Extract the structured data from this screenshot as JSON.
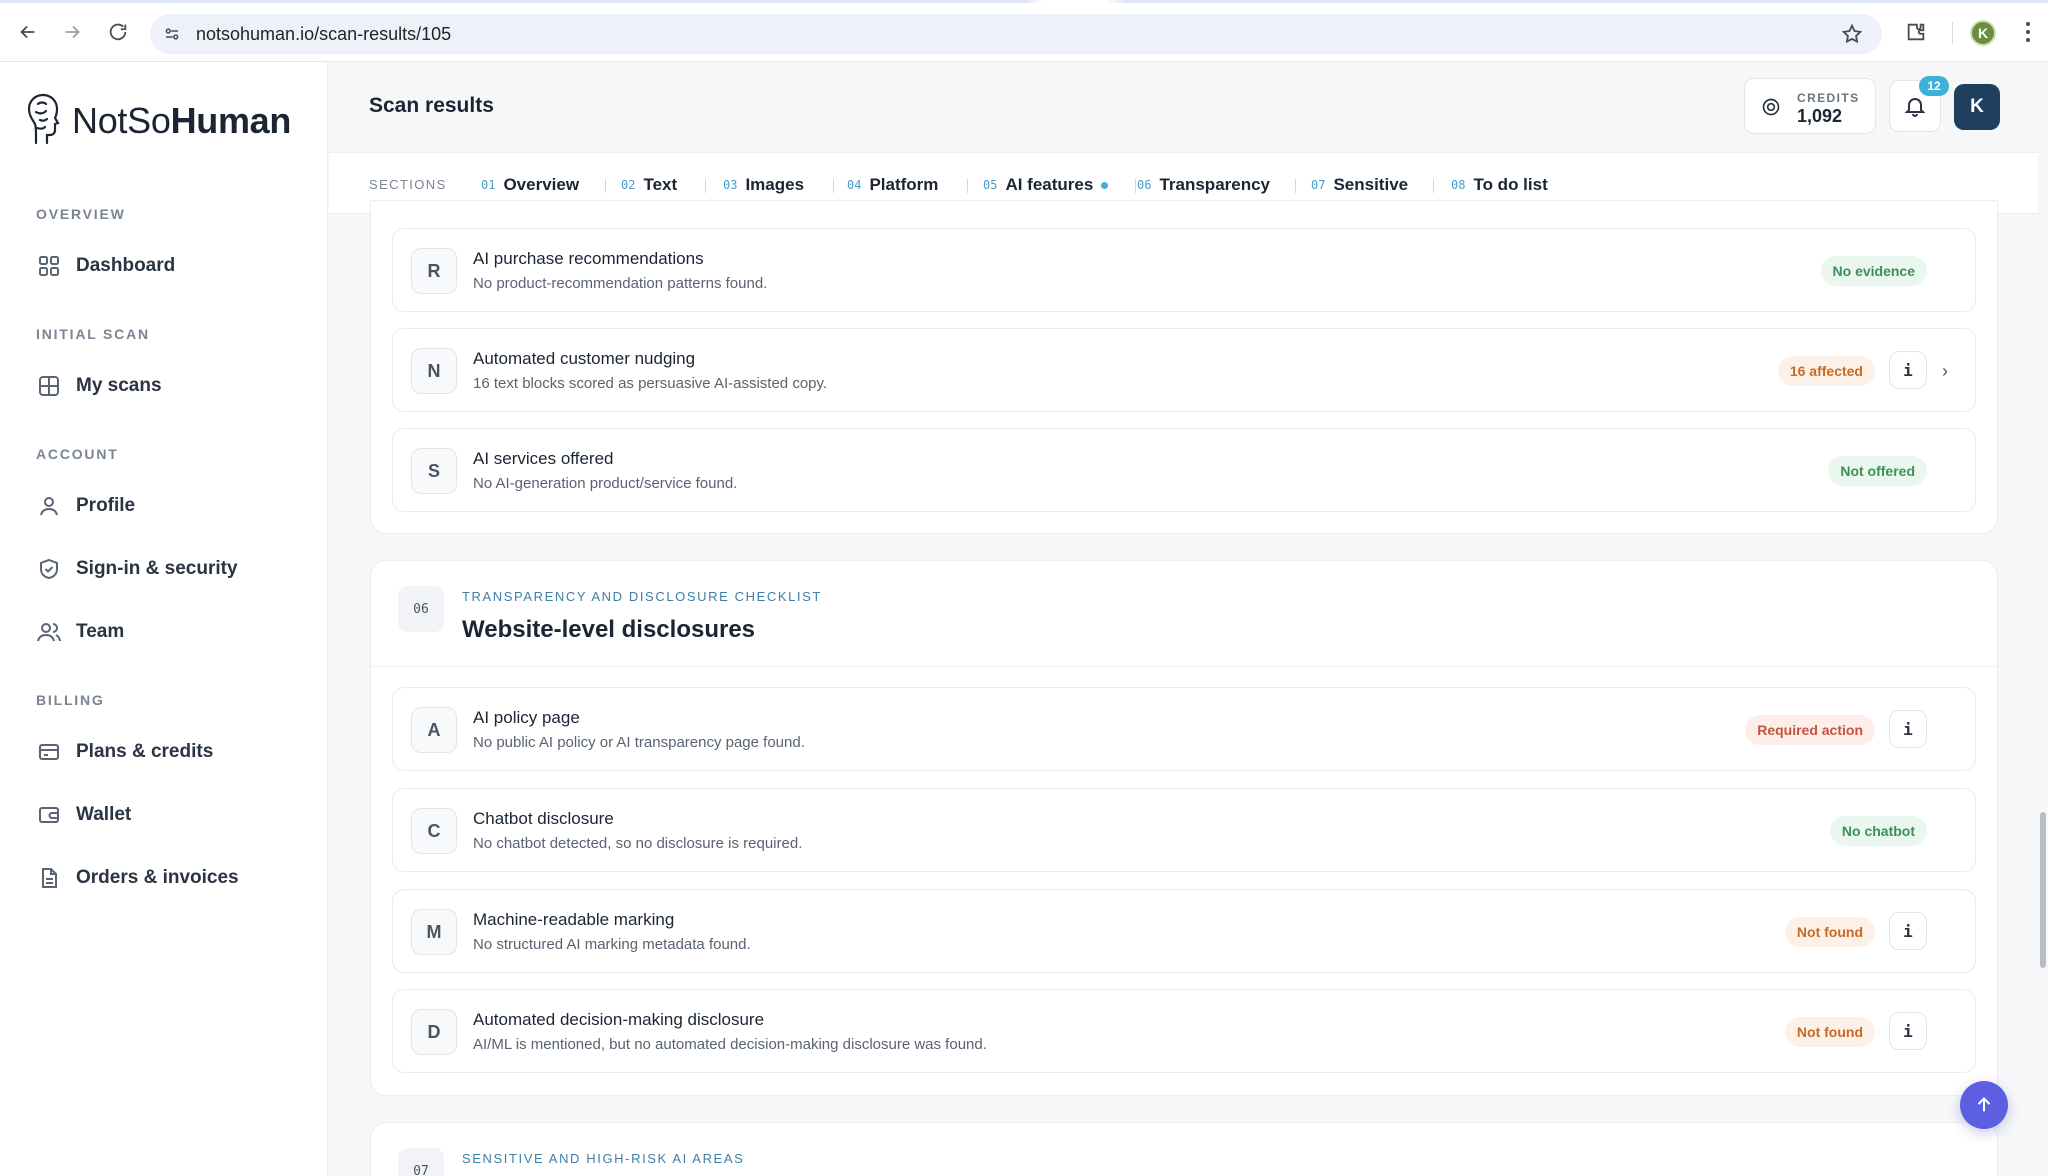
{
  "browser": {
    "url": "notsohuman.io/scan-results/105",
    "profile_initial": "K"
  },
  "brand": {
    "name_light": "NotSo",
    "name_bold": "Human"
  },
  "sidebar": {
    "sections": [
      {
        "title": "OVERVIEW",
        "items": [
          {
            "label": "Dashboard",
            "icon": "grid-icon"
          }
        ]
      },
      {
        "title": "INITIAL SCAN",
        "items": [
          {
            "label": "My scans",
            "icon": "scan-icon"
          }
        ]
      },
      {
        "title": "ACCOUNT",
        "items": [
          {
            "label": "Profile",
            "icon": "user-icon"
          },
          {
            "label": "Sign-in & security",
            "icon": "shield-icon"
          },
          {
            "label": "Team",
            "icon": "team-icon"
          }
        ]
      },
      {
        "title": "BILLING",
        "items": [
          {
            "label": "Plans & credits",
            "icon": "card-icon"
          },
          {
            "label": "Wallet",
            "icon": "wallet-icon"
          },
          {
            "label": "Orders & invoices",
            "icon": "document-icon"
          }
        ]
      }
    ]
  },
  "header": {
    "title": "Scan results",
    "credits_label": "CREDITS",
    "credits_value": "1,092",
    "notifications_count": "12",
    "avatar_initial": "K"
  },
  "tabs": {
    "label": "SECTIONS",
    "items": [
      {
        "num": "01",
        "label": "Overview"
      },
      {
        "num": "02",
        "label": "Text"
      },
      {
        "num": "03",
        "label": "Images"
      },
      {
        "num": "04",
        "label": "Platform"
      },
      {
        "num": "05",
        "label": "AI features"
      },
      {
        "num": "06",
        "label": "Transparency"
      },
      {
        "num": "07",
        "label": "Sensitive"
      },
      {
        "num": "08",
        "label": "To do list"
      }
    ]
  },
  "ai_features_rows": [
    {
      "letter": "R",
      "title": "AI purchase recommendations",
      "desc": "No product-recommendation patterns found.",
      "badge": "No evidence",
      "tone": "green"
    },
    {
      "letter": "N",
      "title": "Automated customer nudging",
      "desc": "16 text blocks scored as persuasive AI-assisted copy.",
      "badge": "16 affected",
      "tone": "orange"
    },
    {
      "letter": "S",
      "title": "AI services offered",
      "desc": "No AI-generation product/service found.",
      "badge": "Not offered",
      "tone": "green"
    }
  ],
  "transparency": {
    "num": "06",
    "eyebrow": "TRANSPARENCY AND DISCLOSURE CHECKLIST",
    "title": "Website-level disclosures",
    "rows": [
      {
        "letter": "A",
        "title": "AI policy page",
        "desc": "No public AI policy or AI transparency page found.",
        "badge": "Required action",
        "tone": "red"
      },
      {
        "letter": "C",
        "title": "Chatbot disclosure",
        "desc": "No chatbot detected, so no disclosure is required.",
        "badge": "No chatbot",
        "tone": "green"
      },
      {
        "letter": "M",
        "title": "Machine-readable marking",
        "desc": "No structured AI marking metadata found.",
        "badge": "Not found",
        "tone": "orange"
      },
      {
        "letter": "D",
        "title": "Automated decision-making disclosure",
        "desc": "AI/ML is mentioned, but no automated decision-making disclosure was found.",
        "badge": "Not found",
        "tone": "orange"
      }
    ]
  },
  "sensitive": {
    "num": "07",
    "eyebrow": "SENSITIVE AND HIGH-RISK AI AREAS"
  },
  "info_symbol": "i",
  "chevron_symbol": "›"
}
